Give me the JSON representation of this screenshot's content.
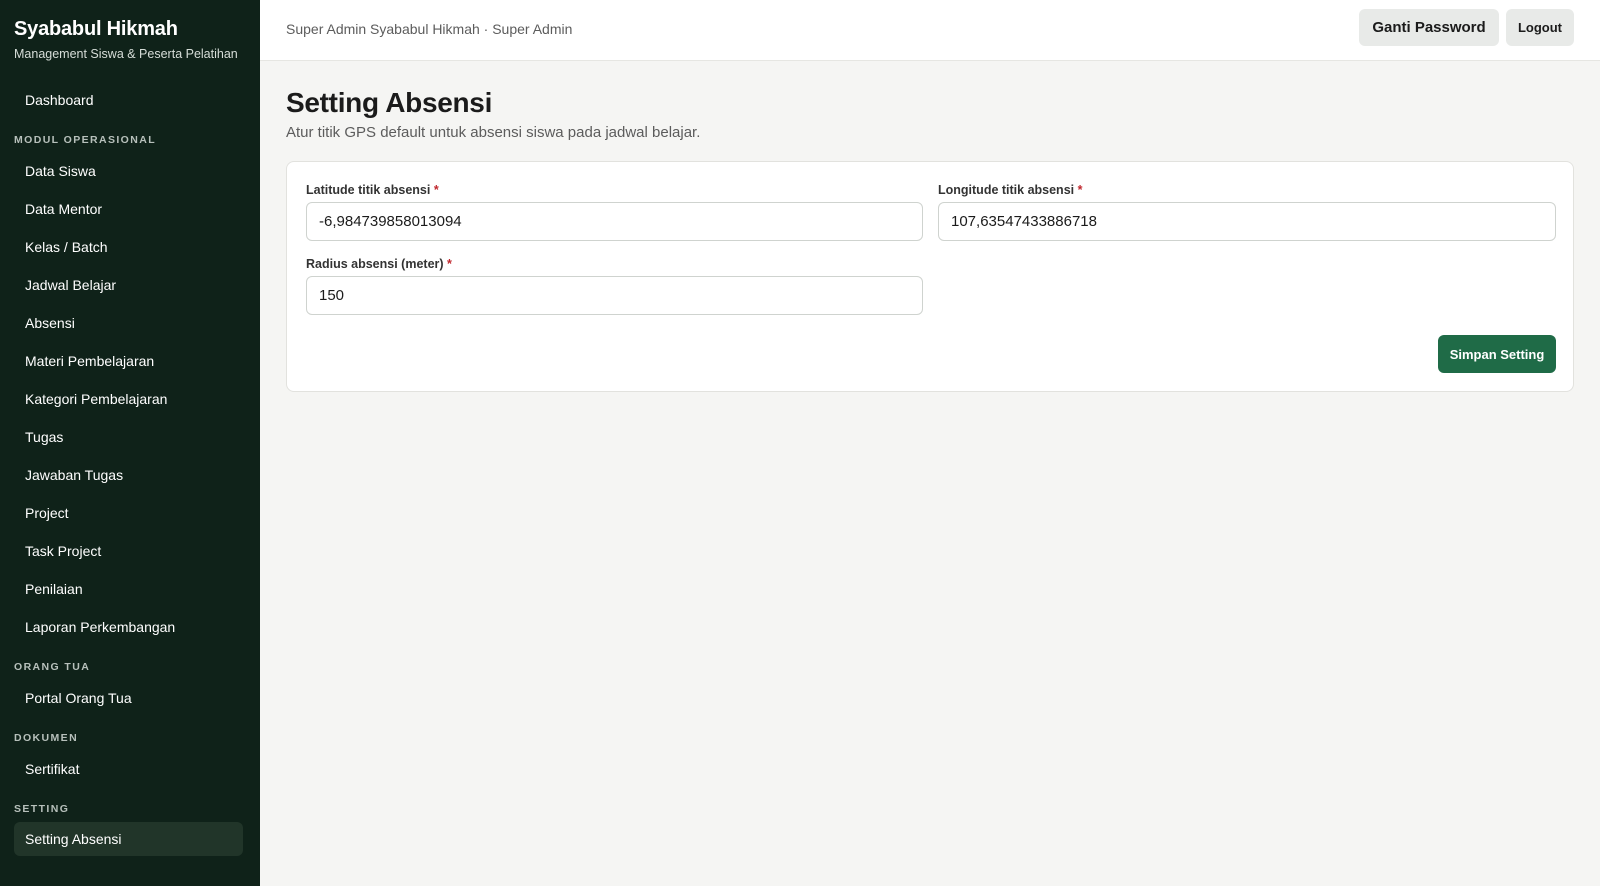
{
  "brand": {
    "title": "Syababul Hikmah",
    "subtitle": "Management Siswa & Peserta Pelatihan"
  },
  "sidebar": {
    "dashboard": "Dashboard",
    "sections": {
      "modul": "MODUL OPERASIONAL",
      "orang_tua": "ORANG TUA",
      "dokumen": "DOKUMEN",
      "setting": "SETTING"
    },
    "modul_items": [
      "Data Siswa",
      "Data Mentor",
      "Kelas / Batch",
      "Jadwal Belajar",
      "Absensi",
      "Materi Pembelajaran",
      "Kategori Pembelajaran",
      "Tugas",
      "Jawaban Tugas",
      "Project",
      "Task Project",
      "Penilaian",
      "Laporan Perkembangan"
    ],
    "orang_tua_items": [
      "Portal Orang Tua"
    ],
    "dokumen_items": [
      "Sertifikat"
    ],
    "setting_items": [
      "Setting Absensi"
    ],
    "active": "Setting Absensi"
  },
  "topbar": {
    "user": "Super Admin Syababul Hikmah · Super Admin",
    "ganti_password": "Ganti Password",
    "logout": "Logout"
  },
  "page": {
    "title": "Setting Absensi",
    "subtitle": "Atur titik GPS default untuk absensi siswa pada jadwal belajar."
  },
  "form": {
    "required_mark": "*",
    "latitude": {
      "label": "Latitude titik absensi",
      "value": "-6,984739858013094"
    },
    "longitude": {
      "label": "Longitude titik absensi",
      "value": "107,63547433886718"
    },
    "radius": {
      "label": "Radius absensi (meter)",
      "value": "150"
    },
    "save_label": "Simpan Setting"
  }
}
